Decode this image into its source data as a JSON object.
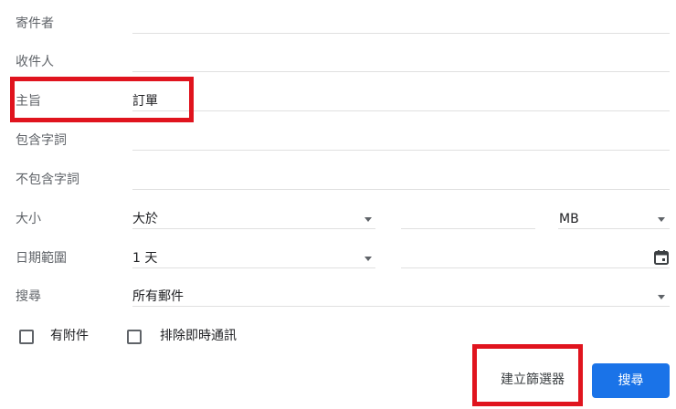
{
  "form": {
    "from": {
      "label": "寄件者",
      "value": ""
    },
    "to": {
      "label": "收件人",
      "value": ""
    },
    "subject": {
      "label": "主旨",
      "value": "訂單"
    },
    "has_words": {
      "label": "包含字詞",
      "value": ""
    },
    "not_words": {
      "label": "不包含字詞",
      "value": ""
    },
    "size": {
      "label": "大小",
      "comparator": "大於",
      "amount": "",
      "unit": "MB"
    },
    "date": {
      "label": "日期範圍",
      "range": "1 天",
      "date_value": ""
    },
    "search": {
      "label": "搜尋",
      "scope": "所有郵件"
    },
    "checkboxes": [
      {
        "label": "有附件",
        "checked": false
      },
      {
        "label": "排除即時通訊",
        "checked": false
      }
    ]
  },
  "actions": {
    "create_filter": "建立篩選器",
    "search": "搜尋"
  },
  "colors": {
    "primary": "#1a73e8",
    "highlight": "#e0141e"
  }
}
